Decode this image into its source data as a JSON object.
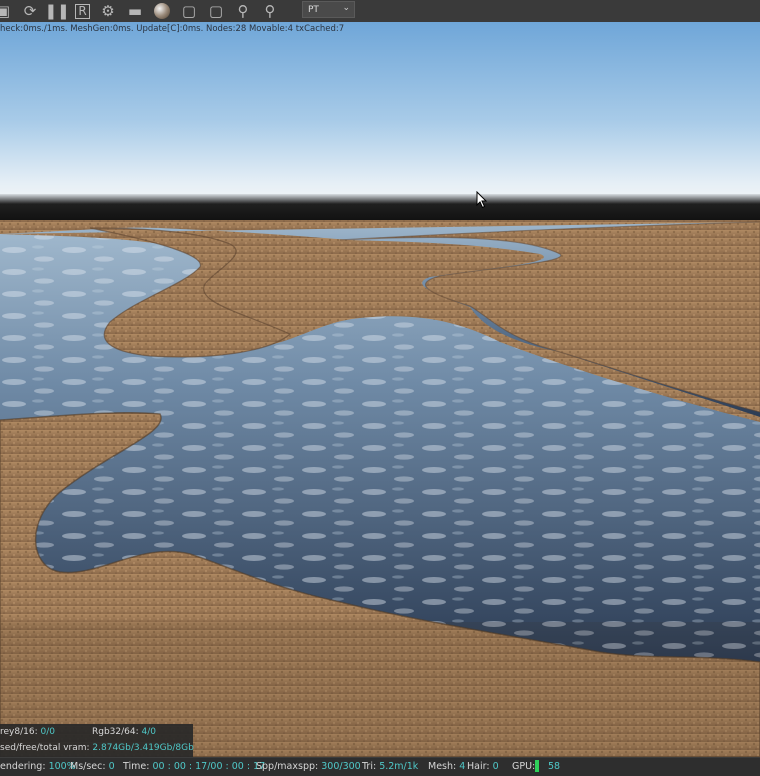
{
  "toolbar": {
    "icons": [
      "checkbox-icon",
      "refresh-icon",
      "pause-icon",
      "r-icon",
      "gear-icon",
      "clapperboard-icon",
      "material-sphere-icon",
      "frame-icon",
      "frame-alt-icon",
      "pin-icon",
      "pin-alt-icon"
    ],
    "mode_select": "PT"
  },
  "debug_line": "heck:0ms./1ms. MeshGen:0ms. Update[C]:0ms. Nodes:28 Movable:4 txCached:7",
  "stats": {
    "grey_label": "rey8/16:",
    "grey_value": "0/0",
    "rgb_label": "Rgb32/64:",
    "rgb_value": "4/0",
    "vram_label": "sed/free/total vram:",
    "vram_value": "2.874Gb/3.419Gb/8Gb"
  },
  "status": {
    "rendering_label": "endering:",
    "rendering_value": "100%",
    "ms_label": "Ms/sec:",
    "ms_value": "0",
    "time_label": "Time:",
    "time_value": "00 : 00 : 17/00 : 00 : 17",
    "spp_label": "Spp/maxspp:",
    "spp_value": "300/300",
    "tri_label": "Tri:",
    "tri_value": "5.2m/1k",
    "mesh_label": "Mesh:",
    "mesh_value": "4",
    "hair_label": "Hair:",
    "hair_value": "0",
    "gpu_label": "GPU:",
    "gpu_value": "58"
  },
  "colors": {
    "accent": "#4fc8c8",
    "toolbar_bg": "#3a3a3a",
    "status_bg": "#2e2e2e",
    "sky_top": "#7aaedc",
    "water": "#4f6c8a",
    "sand": "#a47c56"
  }
}
